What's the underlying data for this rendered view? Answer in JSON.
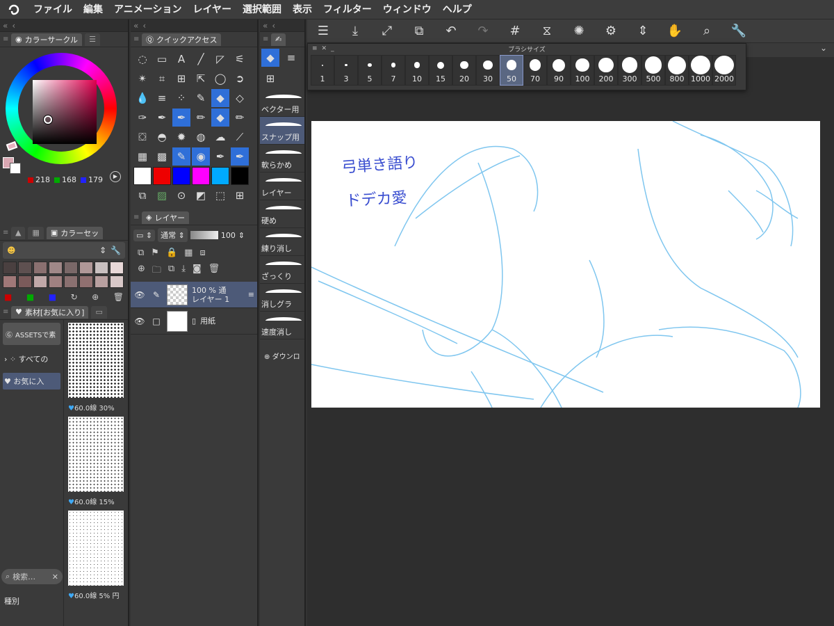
{
  "menu": [
    "ファイル",
    "編集",
    "アニメーション",
    "レイヤー",
    "選択範囲",
    "表示",
    "フィルター",
    "ウィンドウ",
    "ヘルプ"
  ],
  "color_circle": {
    "tab_label": "カラーサークル",
    "rgb": {
      "r": "218",
      "g": "168",
      "b": "179"
    },
    "main_color": "#daa8b3",
    "sub_color": "#ffffff"
  },
  "color_set": {
    "tab_label": "カラーセッ",
    "swatches": [
      "#4a4040",
      "#5e5050",
      "#8a7070",
      "#a08888",
      "#7a6868",
      "#b09898",
      "#c8c0c0",
      "#e8d8d8",
      "#a07878",
      "#7a5a5a",
      "#c0a8a8",
      "#a08080",
      "#8a7070",
      "#907070",
      "#b8a0a0",
      "#d8c8c8"
    ]
  },
  "material": {
    "tab_label": "素材[お気に入り]",
    "assets_label": "ASSETSで素",
    "tree_all": "すべての",
    "tree_fav": "お気に入",
    "tones": [
      "60.0線 30%",
      "60.0線 15%",
      "60.0線 5% 円"
    ],
    "search_placeholder": "検索…",
    "kind_label": "種別"
  },
  "quick_access": {
    "tab_label": "クイックアクセス"
  },
  "layer": {
    "tab_label": "レイヤー",
    "blend_mode": "通常",
    "opacity": "100",
    "layers": [
      {
        "percent": "100 %",
        "mode": "通",
        "name": "レイヤー 1"
      },
      {
        "name": "用紙"
      }
    ]
  },
  "brushes": [
    "ベクター用",
    "スナップ用",
    "軟らかめ",
    "レイヤー",
    "硬め",
    "練り消し",
    "ざっくり",
    "消しグラ",
    "速度消し"
  ],
  "download_label": "ダウンロ",
  "brush_size": {
    "title": "ブラシサイズ",
    "sizes": [
      "1",
      "3",
      "5",
      "7",
      "10",
      "15",
      "20",
      "30",
      "50",
      "70",
      "90",
      "100",
      "200",
      "300",
      "500",
      "800",
      "1000",
      "2000"
    ],
    "selected": "50"
  },
  "canvas": {
    "note_line1": "弓単き語り",
    "note_line2": "ドデカ愛"
  }
}
